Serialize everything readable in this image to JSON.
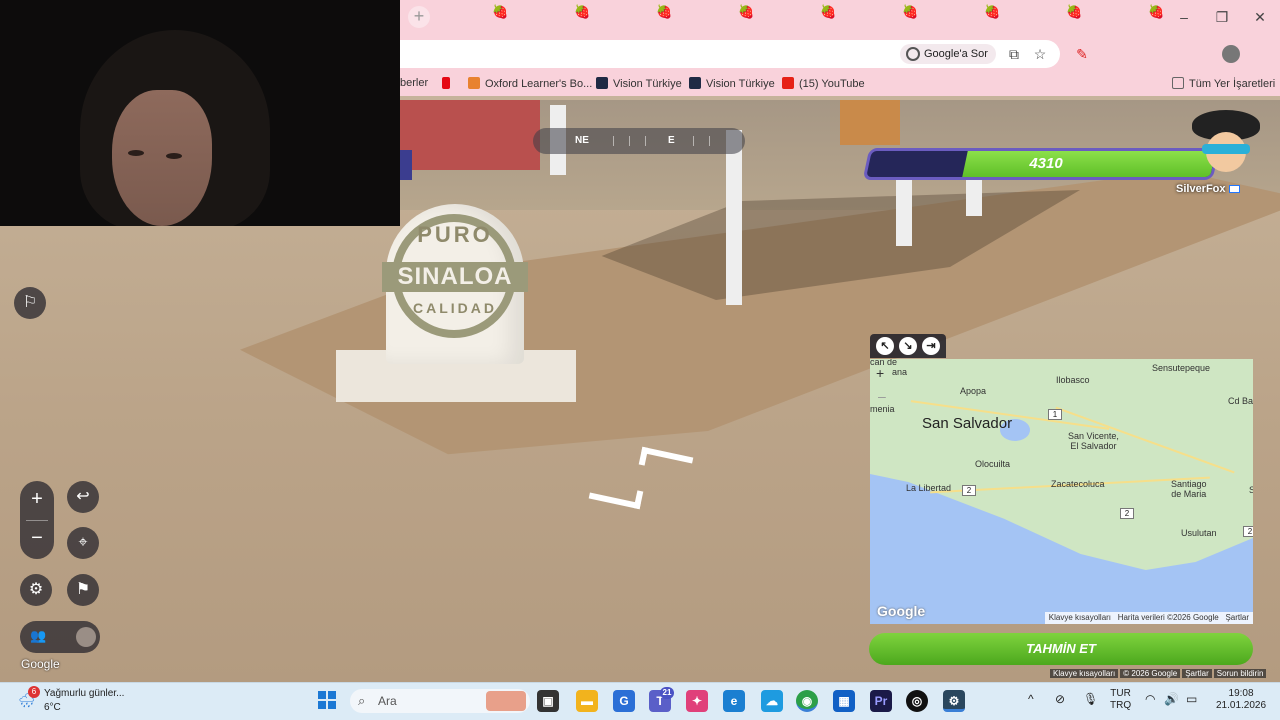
{
  "browser": {
    "bookmarks": [
      {
        "label": "berler",
        "color": "#f9d2db"
      },
      {
        "label": "",
        "color": "#e50914"
      },
      {
        "label": "Oxford Learner's Bo...",
        "color": "#e8822f"
      },
      {
        "label": "Vision Türkiye",
        "color": "#1f2a44"
      },
      {
        "label": "Vision Türkiye",
        "color": "#1f2a44"
      },
      {
        "label": "(15) YouTube",
        "color": "#e62117"
      }
    ],
    "all_bookmarks": "Tüm Yer İşaretleri",
    "ask_google": "Google'a Sor"
  },
  "compass": {
    "ne": "NE",
    "e": "E"
  },
  "score": {
    "value": "4310",
    "player": "SilverFox",
    "fill_fraction": 0.72
  },
  "sign": {
    "top": "PURO",
    "main": "SINALOA",
    "bottom": "CALIDAD"
  },
  "map": {
    "labels": {
      "san_salvador": "San Salvador",
      "apopa": "Apopa",
      "ilobasco": "Ilobasco",
      "sensutepeque": "Sensutepeque",
      "san_vicente": "San Vicente,\nEl Salvador",
      "olocuilta": "Olocuilta",
      "la_libertad": "La Libertad",
      "zacatecoluca": "Zacatecoluca",
      "santiago": "Santiago\nde Maria",
      "usulutan": "Usulutan",
      "cd_ba": "Cd Ba",
      "ana": "ana",
      "menia": "menia",
      "s": "S",
      "can": "can de"
    },
    "shields": {
      "r1": "1",
      "r2a": "2",
      "r2b": "2",
      "r2c": "2"
    },
    "google": "Google",
    "footer": {
      "keys": "Klavye kısayolları",
      "data": "Harita verileri ©2026 Google",
      "terms": "Şartlar"
    },
    "guess_button": "TAHMİN ET"
  },
  "streetview_footer": {
    "keys": "Klavye kısayolları",
    "copyright": "© 2026 Google",
    "terms": "Şartlar",
    "report": "Sorun bildirin"
  },
  "google_logo": "Google",
  "taskbar": {
    "weather_badge": "6",
    "weather_text": "Yağmurlu günler...",
    "temp": "6°C",
    "search_placeholder": "Ara",
    "teams_badge": "21",
    "lang1": "TUR",
    "lang2": "TRQ",
    "time": "19:08",
    "date": "21.01.2026"
  },
  "colors": {
    "accent_green": "#5fbf28",
    "score_bg": "#252659",
    "taskbar": "#dcebf6"
  }
}
